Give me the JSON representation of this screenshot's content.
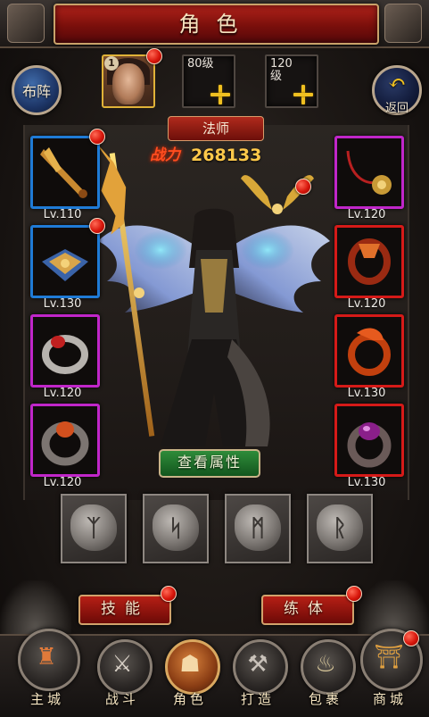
{
  "header": {
    "title": "角色"
  },
  "top": {
    "left_button": "布阵",
    "right_button": "返回",
    "hero_slot_number": "1",
    "slot_80": "80级",
    "slot_120": "120级"
  },
  "character": {
    "class_name": "法师",
    "power_label": "战力",
    "power_value": "268133"
  },
  "equipment": {
    "left": [
      {
        "level": "Lv.110",
        "rarity": "blue",
        "item": "sword-icon",
        "alert": true
      },
      {
        "level": "Lv.130",
        "rarity": "blue",
        "item": "armor-icon",
        "alert": true
      },
      {
        "level": "Lv.120",
        "rarity": "purple",
        "item": "ring-icon",
        "alert": false
      },
      {
        "level": "Lv.120",
        "rarity": "purple",
        "item": "ring-icon",
        "alert": false
      }
    ],
    "right": [
      {
        "level": "Lv.120",
        "rarity": "purple",
        "item": "necklace-icon",
        "alert": false
      },
      {
        "level": "Lv.120",
        "rarity": "red",
        "item": "bracelet-icon",
        "alert": false
      },
      {
        "level": "Lv.130",
        "rarity": "red",
        "item": "dragon-bracelet-icon",
        "alert": false
      },
      {
        "level": "Lv.130",
        "rarity": "red",
        "item": "gem-ring-icon",
        "alert": false
      }
    ]
  },
  "view_attributes": "查看属性",
  "runes": [
    "rune-icon",
    "rune-icon",
    "rune-icon",
    "rune-icon"
  ],
  "actions": {
    "skill": "技能",
    "body": "练体"
  },
  "nav": [
    {
      "label": "主城",
      "icon": "castle-icon"
    },
    {
      "label": "战斗",
      "icon": "crossed-axes-icon"
    },
    {
      "label": "角色",
      "icon": "helmet-icon"
    },
    {
      "label": "打造",
      "icon": "hammer-icon"
    },
    {
      "label": "包裹",
      "icon": "bag-icon"
    },
    {
      "label": "商城",
      "icon": "shop-icon"
    }
  ],
  "colors": {
    "rarity_blue": "#1f7bd6",
    "rarity_purple": "#c026c9",
    "rarity_red": "#d51a18",
    "power_gold": "#ffc94a",
    "alert_red": "#d8160b"
  }
}
